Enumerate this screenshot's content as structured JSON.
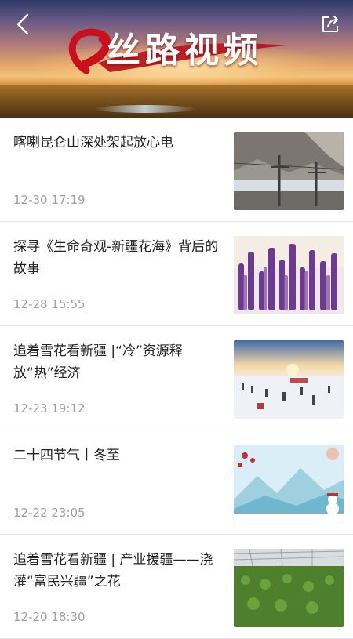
{
  "header": {
    "logo_text": "丝路视频",
    "back_icon": "back-arrow-icon",
    "share_icon": "share-icon"
  },
  "articles": [
    {
      "title": "喀喇昆仑山深处架起放心电",
      "time": "12-30  17:19",
      "thumb": "power-line-mountain-thumbnail"
    },
    {
      "title": "探寻《生命奇观-新疆花海》背后的故事",
      "time": "12-28  15:55",
      "thumb": "lavender-field-thumbnail"
    },
    {
      "title": "追着雪花看新疆 |“冷”资源释放“热”经济",
      "time": "12-23  19:12",
      "thumb": "snow-resort-thumbnail"
    },
    {
      "title": "二十四节气丨冬至",
      "time": "12-22  23:05",
      "thumb": "winter-solstice-thumbnail"
    },
    {
      "title": "追着雪花看新疆 | 产业援疆——浇灌“富民兴疆”之花",
      "time": "12-20  18:30",
      "thumb": "greenhouse-thumbnail"
    }
  ]
}
